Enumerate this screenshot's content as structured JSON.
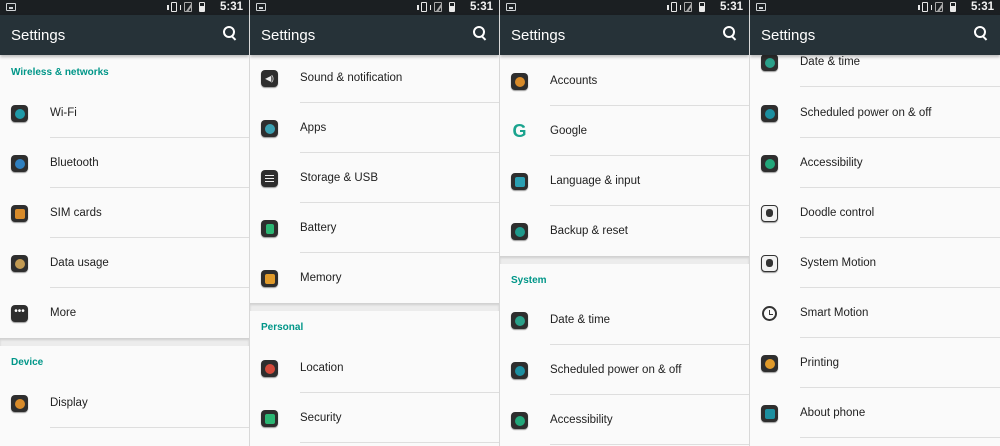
{
  "status_bar": {
    "time": "5:31"
  },
  "screens": [
    {
      "title": "Settings",
      "headers": [
        "Wireless & networks",
        "Device"
      ],
      "items": [
        "Wi-Fi",
        "Bluetooth",
        "SIM cards",
        "Data usage",
        "More",
        "Display"
      ]
    },
    {
      "title": "Settings",
      "headers": [
        "Personal"
      ],
      "items": [
        "Sound & notification",
        "Apps",
        "Storage & USB",
        "Battery",
        "Memory",
        "Location",
        "Security"
      ]
    },
    {
      "title": "Settings",
      "headers": [
        "System"
      ],
      "items": [
        "Accounts",
        "Google",
        "Language & input",
        "Backup & reset",
        "Date & time",
        "Scheduled power on & off",
        "Accessibility"
      ]
    },
    {
      "title": "Settings",
      "headers": [],
      "items": [
        "Date & time",
        "Scheduled power on & off",
        "Accessibility",
        "Doodle control",
        "System Motion",
        "Smart Motion",
        "Printing",
        "About phone"
      ]
    }
  ],
  "icons": {
    "wifi": "wifi-icon",
    "bluetooth": "bluetooth-icon",
    "sim": "sim-card-icon",
    "data": "data-usage-icon",
    "more": "more-dots-icon",
    "display": "display-icon",
    "sound": "sound-icon",
    "apps": "apps-icon",
    "storage": "storage-icon",
    "battery": "battery-icon",
    "memory": "memory-icon",
    "location": "location-icon",
    "security": "security-icon",
    "accounts": "accounts-icon",
    "google": "google-icon",
    "language": "language-icon",
    "backup": "backup-icon",
    "date": "date-time-icon",
    "power": "power-schedule-icon",
    "accessibility": "accessibility-icon",
    "doodle": "doodle-icon",
    "motion": "system-motion-icon",
    "smart": "smart-motion-icon",
    "printing": "printing-icon",
    "about": "about-phone-icon"
  },
  "colors": {
    "appbar": "#263238",
    "accent": "#009688",
    "statusbar": "#1b1f22"
  }
}
